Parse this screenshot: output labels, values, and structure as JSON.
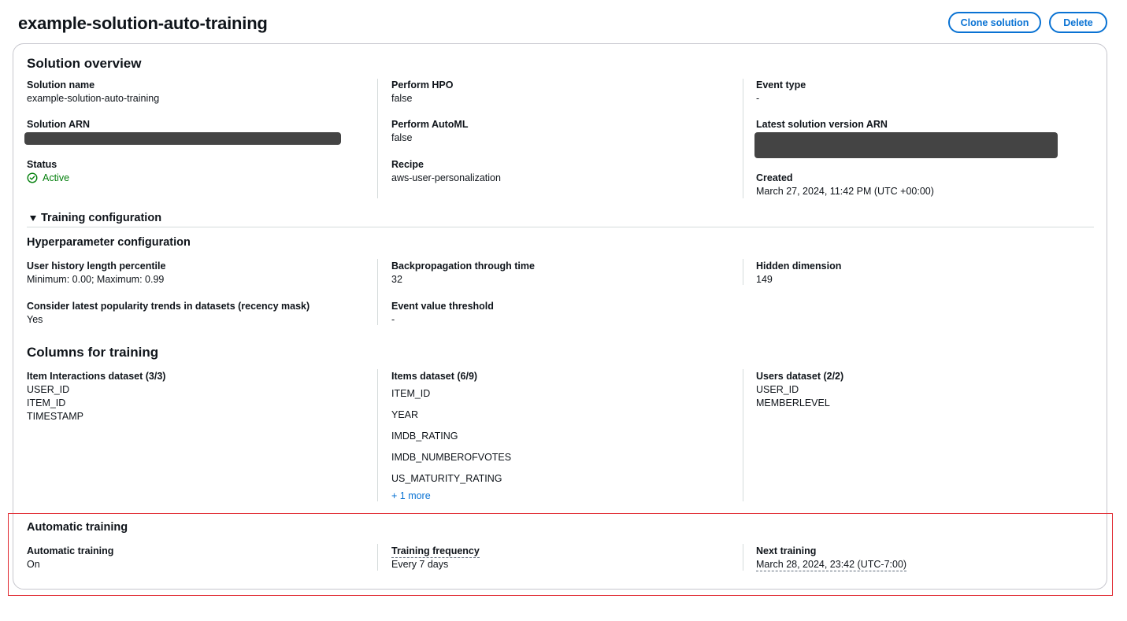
{
  "header": {
    "title": "example-solution-auto-training",
    "clone_label": "Clone solution",
    "delete_label": "Delete"
  },
  "overview": {
    "heading": "Solution overview",
    "solution_name_label": "Solution name",
    "solution_name_value": "example-solution-auto-training",
    "solution_arn_label": "Solution ARN",
    "status_label": "Status",
    "status_value": "Active",
    "perform_hpo_label": "Perform HPO",
    "perform_hpo_value": "false",
    "perform_automl_label": "Perform AutoML",
    "perform_automl_value": "false",
    "recipe_label": "Recipe",
    "recipe_value": "aws-user-personalization",
    "event_type_label": "Event type",
    "event_type_value": "-",
    "latest_version_arn_label": "Latest solution version ARN",
    "created_label": "Created",
    "created_value": "March 27, 2024, 11:42 PM (UTC +00:00)"
  },
  "training_config": {
    "expander_label": "Training configuration",
    "hyper_heading": "Hyperparameter configuration",
    "user_history_label": "User history length percentile",
    "user_history_value": "Minimum: 0.00; Maximum: 0.99",
    "bptt_label": "Backpropagation through time",
    "bptt_value": "32",
    "hidden_dim_label": "Hidden dimension",
    "hidden_dim_value": "149",
    "recency_label": "Consider latest popularity trends in datasets (recency mask)",
    "recency_value": "Yes",
    "event_threshold_label": "Event value threshold",
    "event_threshold_value": "-"
  },
  "columns": {
    "heading": "Columns for training",
    "interactions_label": "Item Interactions dataset (3/3)",
    "interactions": [
      "USER_ID",
      "ITEM_ID",
      "TIMESTAMP"
    ],
    "items_label": "Items dataset (6/9)",
    "items": [
      "ITEM_ID",
      "YEAR",
      "IMDB_RATING",
      "IMDB_NUMBEROFVOTES",
      "US_MATURITY_RATING"
    ],
    "items_more": "+ 1 more",
    "users_label": "Users dataset (2/2)",
    "users": [
      "USER_ID",
      "MEMBERLEVEL"
    ]
  },
  "auto_training": {
    "heading": "Automatic training",
    "auto_label": "Automatic training",
    "auto_value": "On",
    "frequency_label": "Training frequency",
    "frequency_value": "Every 7 days",
    "next_label": "Next training",
    "next_value": "March 28, 2024, 23:42 (UTC-7:00)"
  },
  "colors": {
    "accent": "#0972d3",
    "success": "#037f0c",
    "highlight": "#e0262e",
    "redaction": "#444444"
  },
  "icons": {
    "status": "check-circle-icon",
    "expander": "caret-down-icon"
  }
}
